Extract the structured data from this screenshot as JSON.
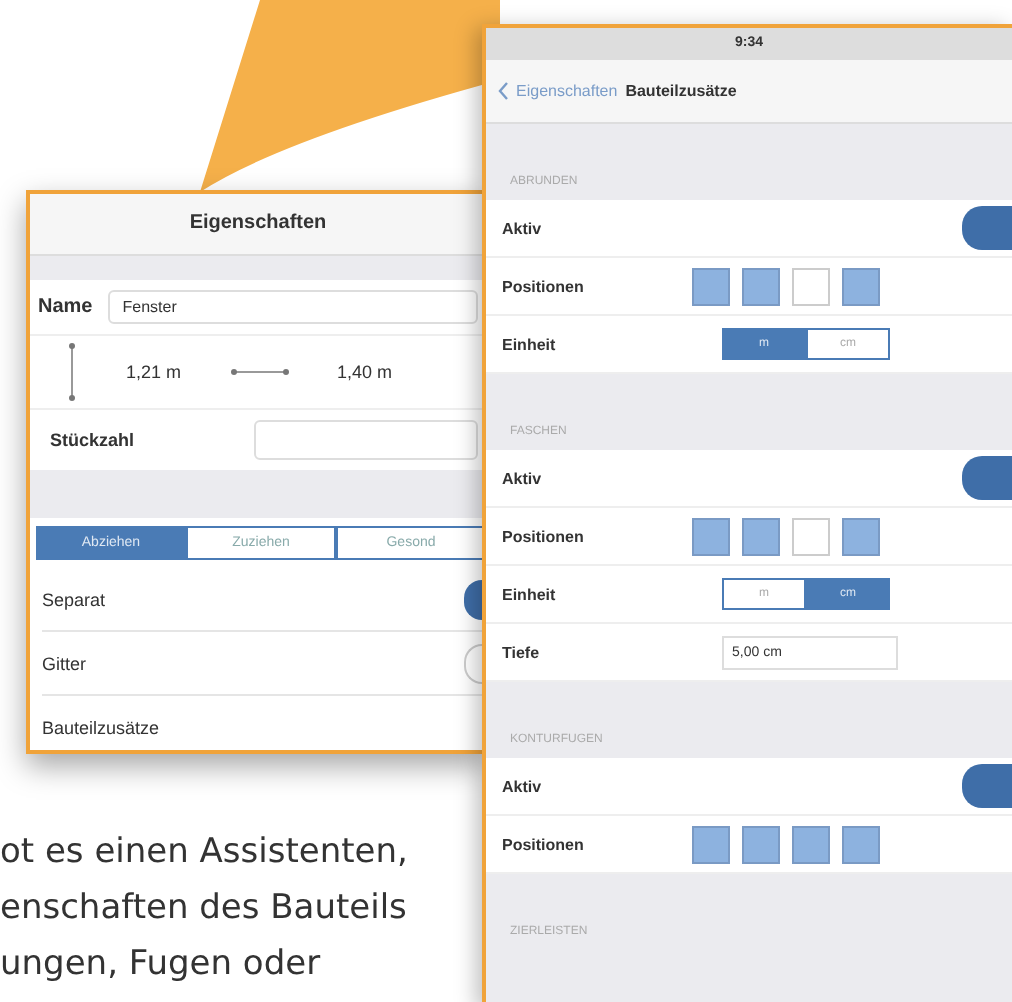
{
  "background_text": [
    "ot es einen Assistenten,",
    "enschaften des Bauteils",
    "ungen, Fugen oder"
  ],
  "left_panel": {
    "title": "Eigenschaften",
    "name_label": "Name",
    "name_value": "Fenster",
    "height": "1,21 m",
    "width": "1,40 m",
    "count_label": "Stückzahl",
    "tabs": [
      {
        "label": "Abziehen",
        "selected": true
      },
      {
        "label": "Zuziehen",
        "selected": false
      },
      {
        "label": "Gesond",
        "selected": false
      }
    ],
    "rows": [
      {
        "label": "Separat",
        "on": true
      },
      {
        "label": "Gitter",
        "on": false
      },
      {
        "label": "Bauteilzusätze"
      }
    ]
  },
  "right_panel": {
    "time": "9:34",
    "back": "Eigenschaften",
    "title": "Bauteilzusätze",
    "sections": [
      {
        "header": "ABRUNDEN",
        "rows": [
          {
            "kind": "toggle",
            "label": "Aktiv",
            "on": true
          },
          {
            "kind": "positions",
            "label": "Positionen",
            "positions": [
              true,
              true,
              false,
              true
            ]
          },
          {
            "kind": "segment",
            "label": "Einheit",
            "options": [
              {
                "label": "m",
                "selected": true
              },
              {
                "label": "cm",
                "selected": false
              }
            ]
          }
        ]
      },
      {
        "header": "FASCHEN",
        "rows": [
          {
            "kind": "toggle",
            "label": "Aktiv",
            "on": true
          },
          {
            "kind": "positions",
            "label": "Positionen",
            "positions": [
              true,
              true,
              false,
              true
            ]
          },
          {
            "kind": "segment",
            "label": "Einheit",
            "options": [
              {
                "label": "m",
                "selected": false
              },
              {
                "label": "cm",
                "selected": true
              }
            ]
          },
          {
            "kind": "value",
            "label": "Tiefe",
            "value": "5,00 cm"
          }
        ]
      },
      {
        "header": "KONTURFUGEN",
        "rows": [
          {
            "kind": "toggle",
            "label": "Aktiv",
            "on": true
          },
          {
            "kind": "positions",
            "label": "Positionen",
            "positions": [
              true,
              true,
              true,
              true
            ]
          }
        ]
      },
      {
        "header": "ZIERLEISTEN"
      }
    ]
  }
}
